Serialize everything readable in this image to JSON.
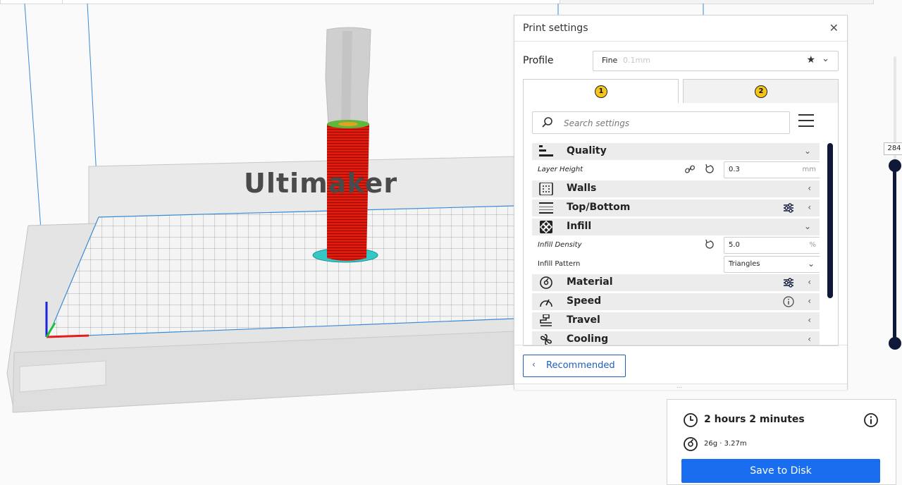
{
  "scene": {
    "brand": "Ultimaker",
    "colors": {
      "model": "#d9180a",
      "brim": "#35c6c6",
      "grid": "#2c3e50",
      "axis_x": "#e11d1d",
      "axis_y": "#1fbf3a",
      "axis_z": "#1a25d6"
    }
  },
  "layer_slider": {
    "value": "284"
  },
  "print_settings": {
    "title": "Print settings",
    "close_icon": "close-icon",
    "profile": {
      "label": "Profile",
      "name": "Fine",
      "detail": "0.1mm"
    },
    "extruder_tabs": [
      {
        "number": "1"
      },
      {
        "number": "2"
      }
    ],
    "search": {
      "placeholder": "Search settings"
    },
    "categories": {
      "quality": "Quality",
      "walls": "Walls",
      "top_bottom": "Top/Bottom",
      "infill": "Infill",
      "material": "Material",
      "speed": "Speed",
      "travel": "Travel",
      "cooling": "Cooling"
    },
    "settings": {
      "layer_height": {
        "label": "Layer Height",
        "value": "0.3",
        "unit": "mm"
      },
      "infill_density": {
        "label": "Infill Density",
        "value": "5.0",
        "unit": "%"
      },
      "infill_pattern": {
        "label": "Infill Pattern",
        "value": "Triangles"
      }
    },
    "recommended_label": "Recommended"
  },
  "job": {
    "time": "2 hours 2 minutes",
    "material": "26g · 3.27m",
    "save_label": "Save to Disk"
  }
}
